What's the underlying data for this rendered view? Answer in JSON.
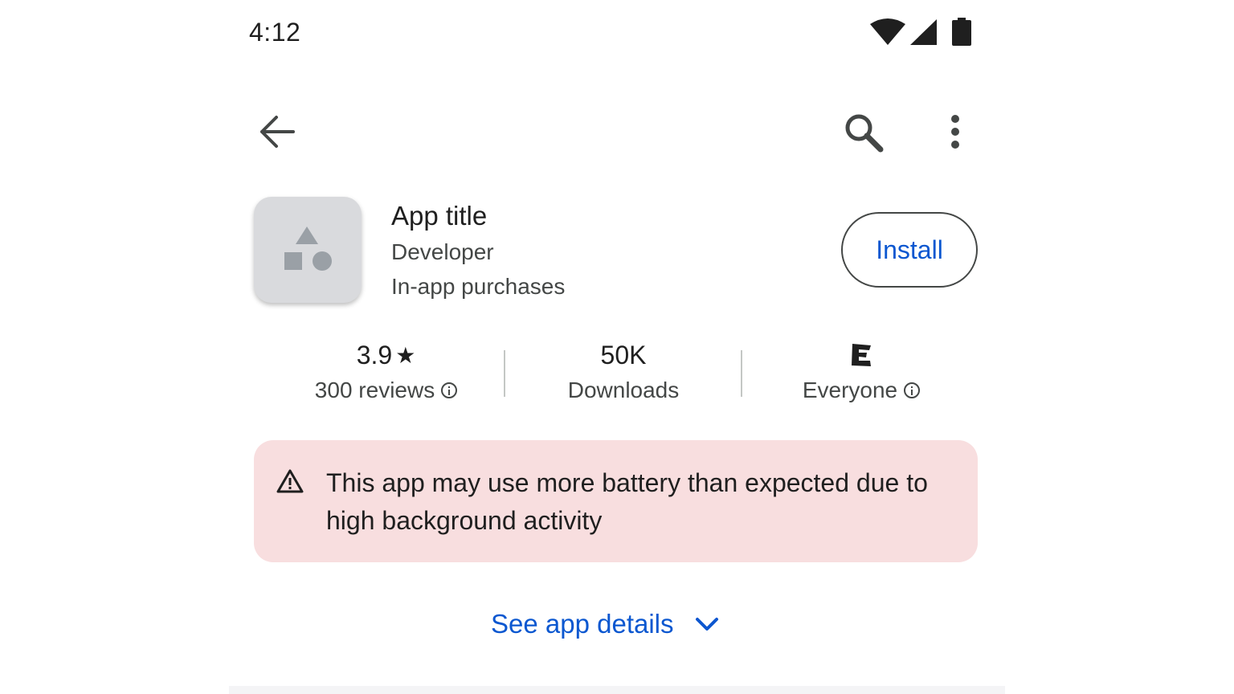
{
  "status_bar": {
    "time": "4:12",
    "icons": [
      "wifi-icon",
      "cellular-signal-icon",
      "battery-icon"
    ]
  },
  "top_bar": {
    "icons": [
      "back-arrow-icon",
      "search-icon",
      "more-vert-icon"
    ]
  },
  "app": {
    "title": "App title",
    "developer": "Developer",
    "purchases": "In-app purchases",
    "install_label": "Install"
  },
  "stats": {
    "rating_value": "3.9",
    "rating_star": "★",
    "reviews_label": "300 reviews",
    "downloads_value": "50K",
    "downloads_label": "Downloads",
    "content_rating_label": "Everyone"
  },
  "warning": {
    "text": "This app may use more battery than expected due to high background activity"
  },
  "details": {
    "label": "See app details"
  },
  "colors": {
    "accent": "#0b57d0",
    "warning_background": "#f8dedf",
    "icon_background": "#d9dadd",
    "text_primary": "#1f1f1f",
    "text_secondary": "#444746"
  }
}
